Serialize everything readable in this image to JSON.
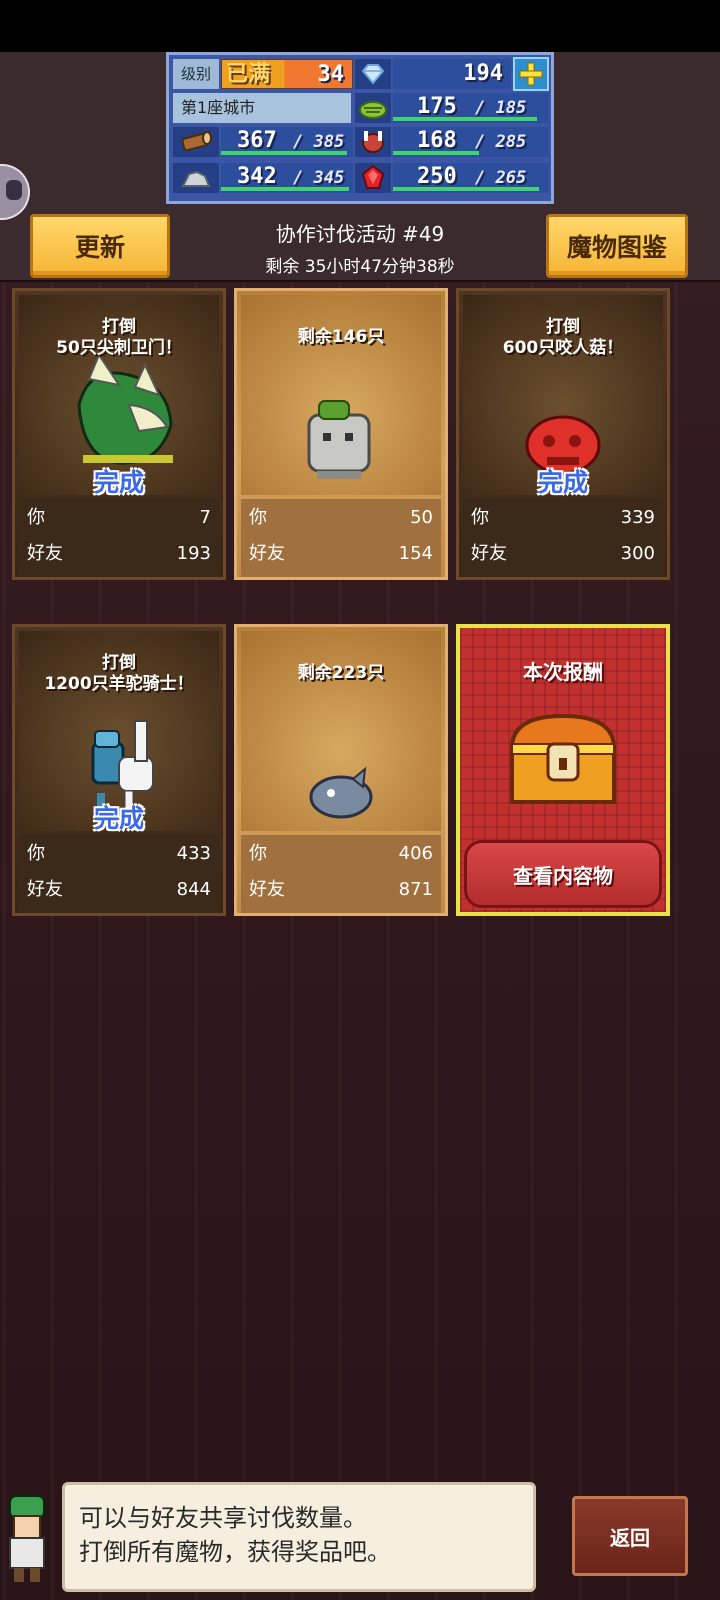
{
  "status": {
    "level_label": "级别",
    "level_max": "已满",
    "level": "34",
    "gems": "194",
    "city": "第1座城市",
    "resources": [
      {
        "name": "wood",
        "icon": "wood-log-icon",
        "current": "367",
        "max": "385"
      },
      {
        "name": "stone",
        "icon": "stone-icon",
        "current": "342",
        "max": "345"
      },
      {
        "name": "grass",
        "icon": "grass-icon",
        "current": "175",
        "max": "185"
      },
      {
        "name": "food",
        "icon": "meat-icon",
        "current": "168",
        "max": "285"
      },
      {
        "name": "ruby",
        "icon": "ruby-icon",
        "current": "250",
        "max": "265"
      }
    ]
  },
  "header": {
    "refresh_label": "更新",
    "bestiary_label": "魔物图鉴",
    "event_title": "协作讨伐活动 #49",
    "event_timer": "剩余 35小时47分钟38秒"
  },
  "cards": [
    {
      "state": "done",
      "line1": "打倒",
      "line2": "50只尖刺卫门！",
      "done_text": "完成",
      "you_label": "你",
      "you": "7",
      "friend_label": "好友",
      "friend": "193",
      "monster": "green-dragon-sprite"
    },
    {
      "state": "active",
      "line1": "剩余146只",
      "line2": "",
      "done_text": "",
      "you_label": "你",
      "you": "50",
      "friend_label": "好友",
      "friend": "154",
      "monster": "stone-golem-sprite"
    },
    {
      "state": "done",
      "line1": "打倒",
      "line2": "600只咬人菇！",
      "done_text": "完成",
      "you_label": "你",
      "you": "339",
      "friend_label": "好友",
      "friend": "300",
      "monster": "red-mushroom-sprite"
    },
    {
      "state": "done",
      "line1": "打倒",
      "line2": "1200只羊驼骑士！",
      "done_text": "完成",
      "you_label": "你",
      "you": "433",
      "friend_label": "好友",
      "friend": "844",
      "monster": "alpaca-knight-sprite"
    },
    {
      "state": "active",
      "line1": "剩余223只",
      "line2": "",
      "done_text": "",
      "you_label": "你",
      "you": "406",
      "friend_label": "好友",
      "friend": "871",
      "monster": "grey-fish-sprite"
    }
  ],
  "reward": {
    "title": "本次报酬",
    "button_label": "查看内容物"
  },
  "dialog": {
    "line1": "可以与好友共享讨伐数量。",
    "line2": "打倒所有魔物，获得奖品吧。"
  },
  "back_label": "返回",
  "colors": {
    "accent_gold": "#f6b535",
    "reward_red": "#c23030",
    "done_blue": "#3a68e8",
    "bar_green": "#3ed66a"
  }
}
